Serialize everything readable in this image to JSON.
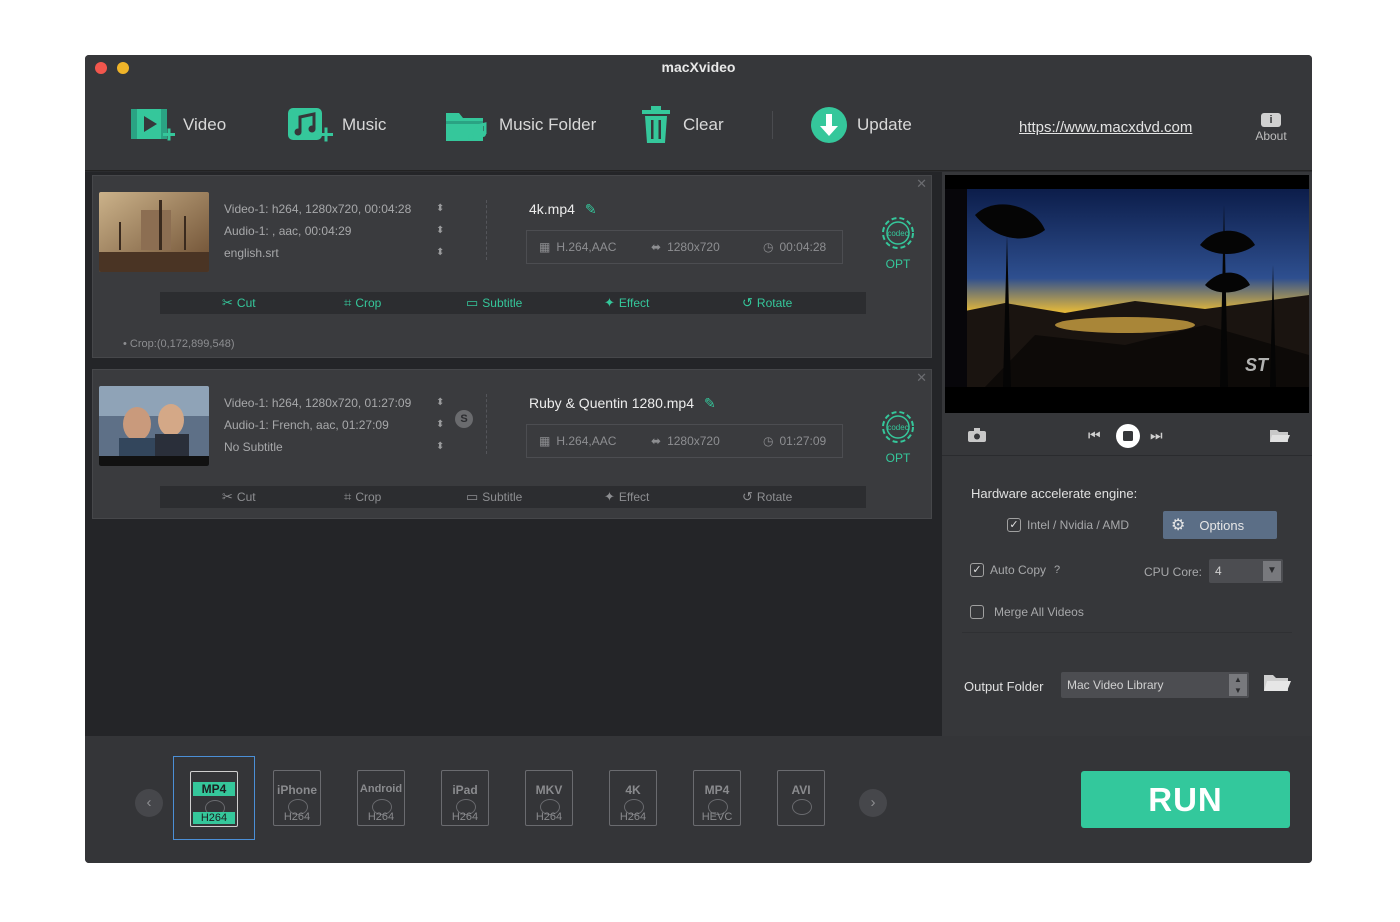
{
  "window": {
    "title": "macXvideo"
  },
  "toolbar": {
    "video_label": "Video",
    "music_label": "Music",
    "music_folder_label": "Music Folder",
    "clear_label": "Clear",
    "update_label": "Update",
    "url": "https://www.macxdvd.com",
    "about_label": "About",
    "about_icon_text": "i"
  },
  "files": [
    {
      "video_info": "Video-1: h264, 1280x720, 00:04:28",
      "audio_info": "Audio-1: , aac, 00:04:29",
      "subtitle_info": "english.srt",
      "output_name": "4k.mp4",
      "codec_spec": "H.264,AAC",
      "resolution_spec": "1280x720",
      "duration_spec": "00:04:28",
      "note": "Crop:(0,172,899,548)"
    },
    {
      "video_info": "Video-1: h264, 1280x720, 01:27:09",
      "audio_info": "Audio-1: French, aac, 01:27:09",
      "subtitle_info": "No Subtitle",
      "output_name": "Ruby & Quentin 1280.mp4",
      "codec_spec": "H.264,AAC",
      "resolution_spec": "1280x720",
      "duration_spec": "01:27:09",
      "badge": "S"
    }
  ],
  "card_common": {
    "codec_icon_label": "codec",
    "opt_label": "OPT",
    "cut_label": "Cut",
    "crop_label": "Crop",
    "subtitle_label": "Subtitle",
    "effect_label": "Effect",
    "rotate_label": "Rotate"
  },
  "settings": {
    "hw_title": "Hardware accelerate engine:",
    "intel_label": "Intel / Nvidia / AMD",
    "intel_checked": true,
    "options_label": "Options",
    "auto_copy_label": "Auto Copy",
    "auto_copy_help": "?",
    "auto_copy_checked": true,
    "cpu_core_label": "CPU Core:",
    "cpu_core_value": "4",
    "merge_label": "Merge All Videos",
    "merge_checked": false,
    "output_folder_label": "Output Folder",
    "output_folder_value": "Mac Video Library"
  },
  "formats": [
    {
      "top": "MP4",
      "bottom": "H264",
      "selected": true
    },
    {
      "top": "iPhone",
      "bottom": "H264",
      "selected": false
    },
    {
      "top": "Android",
      "bottom": "H264",
      "selected": false
    },
    {
      "top": "iPad",
      "bottom": "H264",
      "selected": false
    },
    {
      "top": "MKV",
      "bottom": "H264",
      "selected": false
    },
    {
      "top": "4K",
      "bottom": "H264",
      "selected": false
    },
    {
      "top": "MP4",
      "bottom": "HEVC",
      "selected": false
    },
    {
      "top": "AVI",
      "bottom": "",
      "selected": false
    }
  ],
  "run_label": "RUN",
  "colors": {
    "accent": "#35c79b",
    "run": "#33c89c",
    "selection": "#4b8fd6",
    "options_button": "#5b6e86"
  }
}
